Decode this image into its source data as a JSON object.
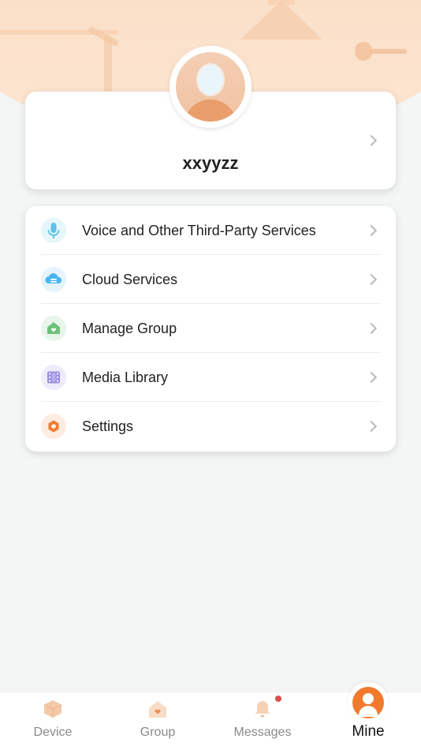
{
  "profile": {
    "username": "xxyyzz",
    "avatar_icon": "user-avatar-icon"
  },
  "menu": {
    "items": [
      {
        "label": "Voice and Other Third-Party Services",
        "icon": "microphone-icon",
        "color": "#5ec3e6",
        "bg": "#e6f6fb"
      },
      {
        "label": "Cloud Services",
        "icon": "cloud-icon",
        "color": "#47b5f0",
        "bg": "#e4f3fc"
      },
      {
        "label": "Manage Group",
        "icon": "home-heart-icon",
        "color": "#6cc17a",
        "bg": "#e8f5ea"
      },
      {
        "label": "Media Library",
        "icon": "film-icon",
        "color": "#9a8fe0",
        "bg": "#eeecfa"
      },
      {
        "label": "Settings",
        "icon": "hexagon-gear-icon",
        "color": "#f27a2f",
        "bg": "#fdece1"
      }
    ]
  },
  "tabbar": {
    "tabs": [
      {
        "label": "Device",
        "icon": "box-icon",
        "active": false
      },
      {
        "label": "Group",
        "icon": "house-heart-icon",
        "active": false
      },
      {
        "label": "Messages",
        "icon": "bell-icon",
        "active": false,
        "has_badge": true
      },
      {
        "label": "Mine",
        "icon": "person-icon",
        "active": true
      }
    ]
  },
  "colors": {
    "accent": "#f17a2d",
    "header_bg": "#fbdcc3",
    "page_bg": "#f4f6f6",
    "badge": "#e24b4b"
  }
}
